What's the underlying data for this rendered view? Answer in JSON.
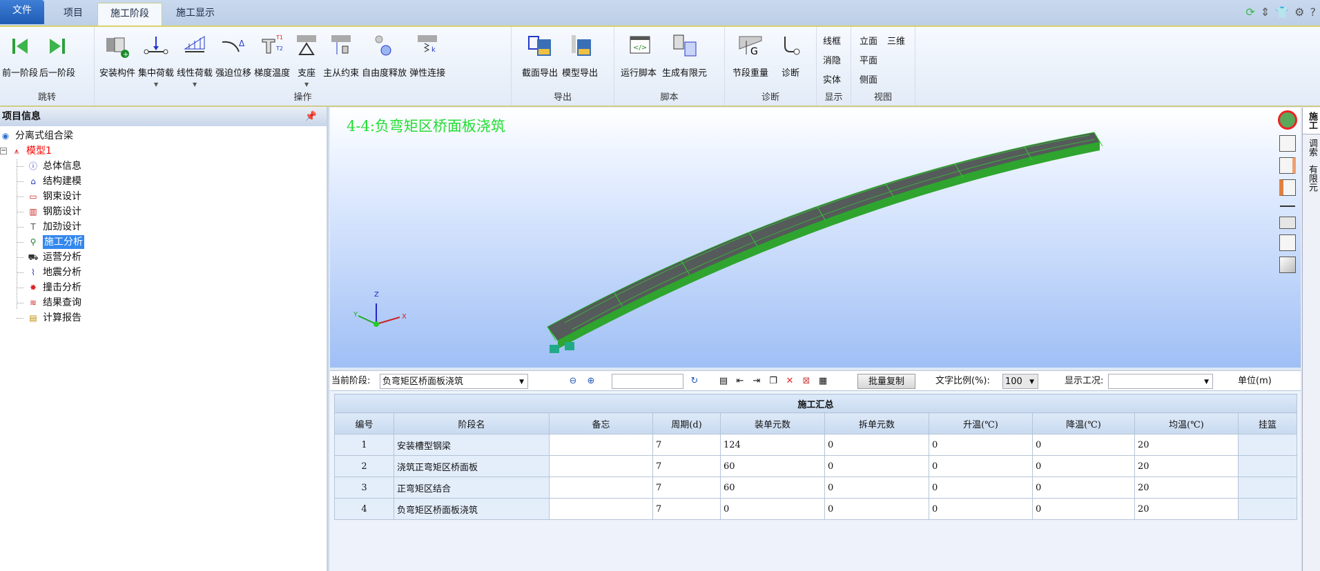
{
  "tabs": [
    {
      "label": "文件"
    },
    {
      "label": "项目"
    },
    {
      "label": "施工阶段"
    },
    {
      "label": "施工显示"
    }
  ],
  "top_icons": [
    "refresh-icon",
    "updown-icon",
    "shirt-icon",
    "gear-icon",
    "help-icon"
  ],
  "ribbon": {
    "groups": [
      {
        "label": "跳转",
        "buttons": [
          {
            "label": "前一阶段",
            "icon": "first-icon"
          },
          {
            "label": "后一阶段",
            "icon": "last-icon"
          }
        ]
      },
      {
        "label": "操作",
        "buttons": [
          {
            "label": "安装构件",
            "icon": "install-icon"
          },
          {
            "label": "集中荷载",
            "icon": "point-load-icon",
            "dropdown": true
          },
          {
            "label": "线性荷载",
            "icon": "line-load-icon",
            "dropdown": true
          },
          {
            "label": "强迫位移",
            "icon": "displacement-icon"
          },
          {
            "label": "梯度温度",
            "icon": "gradient-temp-icon"
          },
          {
            "label": "支座",
            "icon": "support-icon",
            "dropdown": true
          },
          {
            "label": "主从约束",
            "icon": "master-slave-icon"
          },
          {
            "label": "自由度释放",
            "icon": "dof-release-icon"
          },
          {
            "label": "弹性连接",
            "icon": "elastic-link-icon"
          }
        ]
      },
      {
        "label": "导出",
        "buttons": [
          {
            "label": "截面导出",
            "icon": "dwg-export-icon"
          },
          {
            "label": "模型导出",
            "icon": "dwg-model-icon"
          }
        ]
      },
      {
        "label": "脚本",
        "buttons": [
          {
            "label": "运行脚本",
            "icon": "script-icon"
          },
          {
            "label": "生成有限元",
            "icon": "fem-icon"
          }
        ]
      },
      {
        "label": "诊断",
        "buttons": [
          {
            "label": "节段重量",
            "icon": "weight-icon"
          },
          {
            "label": "诊断",
            "icon": "stethoscope-icon"
          }
        ]
      },
      {
        "label": "显示",
        "items": [
          "线框",
          "消隐",
          "实体"
        ]
      },
      {
        "label": "视图",
        "items": [
          "立面",
          "三维",
          "平面",
          "侧面"
        ]
      }
    ]
  },
  "left_panel": {
    "title": "项目信息",
    "root": "分离式组合梁",
    "model": "模型1",
    "items": [
      "总体信息",
      "结构建模",
      "钢束设计",
      "钢筋设计",
      "加劲设计",
      "施工分析",
      "运营分析",
      "地震分析",
      "撞击分析",
      "结果查询",
      "计算报告"
    ],
    "selected": "施工分析"
  },
  "viewport": {
    "title": "4-4:负弯矩区桥面板浇筑",
    "axes": {
      "x": "X",
      "y": "Y",
      "z": "Z"
    }
  },
  "right_tabs": [
    "施工",
    "调索",
    "有限元"
  ],
  "toolbar": {
    "stage_label": "当前阶段:",
    "stage_value": "负弯矩区桥面板浇筑",
    "batch_copy": "批量复制",
    "scale_label": "文字比例(%):",
    "scale_value": "100",
    "case_label": "显示工况:",
    "case_value": "",
    "unit": "单位(m)"
  },
  "table": {
    "title": "施工汇总",
    "columns": [
      "编号",
      "阶段名",
      "备忘",
      "周期(d)",
      "装单元数",
      "拆单元数",
      "升温(℃)",
      "降温(℃)",
      "均温(℃)",
      "挂篮"
    ],
    "rows": [
      [
        "1",
        "安装槽型钢梁",
        "",
        "7",
        "124",
        "0",
        "0",
        "0",
        "20",
        ""
      ],
      [
        "2",
        "浇筑正弯矩区桥面板",
        "",
        "7",
        "60",
        "0",
        "0",
        "0",
        "20",
        ""
      ],
      [
        "3",
        "正弯矩区结合",
        "",
        "7",
        "60",
        "0",
        "0",
        "0",
        "20",
        ""
      ],
      [
        "4",
        "负弯矩区桥面板浇筑",
        "",
        "7",
        "0",
        "0",
        "0",
        "0",
        "20",
        ""
      ]
    ]
  },
  "colors": {
    "accent": "#3388ee",
    "title_green": "#22dd33",
    "file_tab": "#2a68c2"
  }
}
